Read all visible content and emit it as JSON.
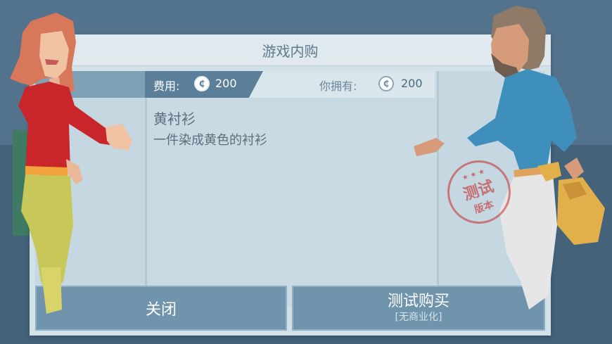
{
  "dialog": {
    "title": "游戏内购"
  },
  "price": {
    "label": "费用:",
    "value": "200",
    "coin_icon": "coin-icon"
  },
  "owned": {
    "label": "你拥有:",
    "value": "200",
    "coin_icon": "coin-icon"
  },
  "item": {
    "name": "黄衬衫",
    "description": "一件染成黄色的衬衫"
  },
  "buttons": {
    "close_label": "关闭",
    "buy_label": "测试购买",
    "buy_sublabel": "[无商业化]"
  },
  "stamp": {
    "main": "测试",
    "sub": "版本"
  },
  "colors": {
    "background": "#4d6b86",
    "button": "#6f94ab",
    "stamp_red": "#c82828"
  }
}
